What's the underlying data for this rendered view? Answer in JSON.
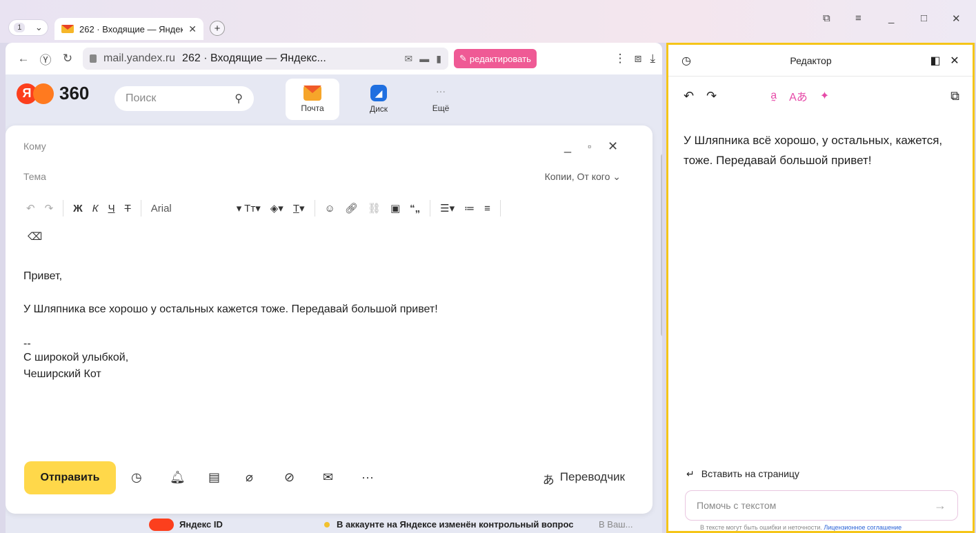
{
  "browser": {
    "tab_counter": "1",
    "tab_title": "262 · Входящие — Яндекс",
    "url_domain": "mail.yandex.ru",
    "url_page_title": "262 · Входящие — Яндекс...",
    "edit_button": "редактировать"
  },
  "mail": {
    "search_placeholder": "Поиск",
    "services": [
      "Почта",
      "Диск",
      "Ещё"
    ],
    "fields": {
      "to": "Кому",
      "subject": "Тема",
      "copies": "Копии, От кого"
    },
    "font_name": "Arial",
    "body": {
      "greeting": "Привет,",
      "text": "У Шляпника все хорошо у остальных кажется тоже. Передавай большой привет!",
      "sig_sep": "--",
      "sig_line1": "С широкой улыбкой,",
      "sig_line2": "Чеширский Кот"
    },
    "send_label": "Отправить",
    "translator_label": "Переводчик",
    "list_row": {
      "sender": "Яндекс ID",
      "subject": "В аккаунте на Яндексе изменён контрольный вопрос",
      "snippet": "В Ваш..."
    }
  },
  "editor": {
    "title": "Редактор",
    "text": "У Шляпника всё хорошо, у остальных, кажется, тоже. Передавай большой привет!",
    "insert_label": "Вставить на страницу",
    "help_placeholder": "Помочь с текстом",
    "disclaimer": "В тексте могут быть ошибки и неточности.",
    "license_link": "Лицензионное соглашение"
  },
  "colors": {
    "send_button": "#ffd84a",
    "editor_border": "#f5c518",
    "edit_button": "#ef5a95"
  }
}
